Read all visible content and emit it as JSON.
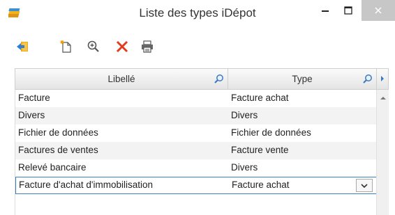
{
  "window": {
    "title": "Liste des types iDépot",
    "icons": {
      "app": "folders-app-icon",
      "minimize": "minimize-icon",
      "maximize": "maximize-icon",
      "close": "close-icon"
    }
  },
  "toolbar": {
    "buttons": [
      {
        "name": "exit-button",
        "icon": "exit-icon"
      },
      {
        "name": "new-button",
        "icon": "new-document-icon"
      },
      {
        "name": "zoom-button",
        "icon": "magnifier-plus-icon"
      },
      {
        "name": "delete-button",
        "icon": "red-x-icon"
      },
      {
        "name": "print-button",
        "icon": "printer-icon"
      }
    ]
  },
  "table": {
    "columns": [
      {
        "label": "Libellé",
        "searchable": true
      },
      {
        "label": "Type",
        "searchable": true
      }
    ],
    "rows": [
      {
        "libelle": "Facture",
        "type": "Facture achat"
      },
      {
        "libelle": "Divers",
        "type": "Divers"
      },
      {
        "libelle": "Fichier de données",
        "type": "Fichier de données"
      },
      {
        "libelle": "Factures de  ventes",
        "type": "Facture vente"
      },
      {
        "libelle": "Relevé bancaire",
        "type": "Divers"
      },
      {
        "libelle": "Facture d'achat d'immobilisation",
        "type": "Facture achat",
        "selected": true
      }
    ]
  },
  "colors": {
    "selection_border": "#3c7fc1",
    "delete_red": "#e03c1e",
    "row_alt": "#f3f3f3",
    "header_grad_end": "#e4e4e4"
  }
}
